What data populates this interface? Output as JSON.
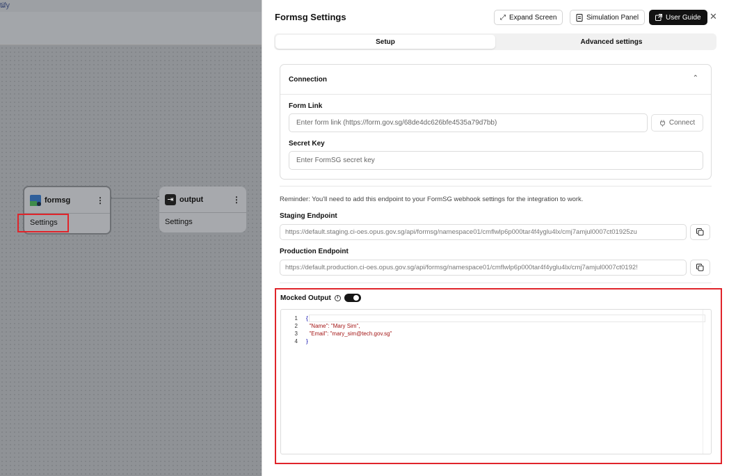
{
  "app": {
    "breadcrumb_fragment": "tify"
  },
  "nodes": [
    {
      "label": "formsg",
      "settings": "Settings"
    },
    {
      "label": "output",
      "settings": "Settings"
    }
  ],
  "panel": {
    "title": "Formsg Settings",
    "buttons": {
      "expand": "Expand Screen",
      "simulation": "Simulation Panel",
      "guide": "User Guide"
    },
    "tabs": {
      "setup": "Setup",
      "advanced": "Advanced settings"
    },
    "connection": {
      "title": "Connection",
      "form_link_label": "Form Link",
      "form_link_placeholder": "Enter form link (https://form.gov.sg/68de4dc626bfe4535a79d7bb)",
      "connect_label": "Connect",
      "secret_key_label": "Secret Key",
      "secret_key_placeholder": "Enter FormSG secret key"
    },
    "reminder": "Reminder: You'll need to add this endpoint to your FormSG webhook settings for the integration to work.",
    "staging": {
      "label": "Staging Endpoint",
      "value": "https://default.staging.ci-oes.opus.gov.sg/api/formsg/namespace01/cmflwlp6p000tar4f4yglu4lx/cmj7amjul0007ct01925zu"
    },
    "production": {
      "label": "Production Endpoint",
      "value": "https://default.production.ci-oes.opus.gov.sg/api/formsg/namespace01/cmflwlp6p000tar4f4yglu4lx/cmj7amjul0007ct0192!"
    },
    "mocked_output": {
      "label": "Mocked Output",
      "enabled": true,
      "lines": [
        {
          "n": "1",
          "text": "{"
        },
        {
          "n": "2",
          "text": "  \"Name\": \"Mary Sim\","
        },
        {
          "n": "3",
          "text": "  \"Email\": \"mary_sim@tech.gov.sg\""
        },
        {
          "n": "4",
          "text": "}"
        }
      ]
    }
  },
  "colors": {
    "highlight": "#e0242a",
    "canvas": "#8f9296",
    "dark_button": "#121212"
  }
}
